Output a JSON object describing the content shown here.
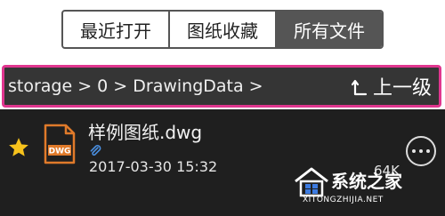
{
  "tabs": [
    {
      "label": "最近打开",
      "active": false
    },
    {
      "label": "图纸收藏",
      "active": false
    },
    {
      "label": "所有文件",
      "active": true
    }
  ],
  "breadcrumb": {
    "path": "storage > 0 > DrawingData >",
    "up_label": "上一级",
    "up_icon": "return-up-icon"
  },
  "file": {
    "name": "样例图纸.dwg",
    "date": "2017-03-30 15:32",
    "size": "64K",
    "type_label": "DWG",
    "favorite": true
  },
  "watermark": {
    "text": "系统之家",
    "url": "XITONGZHIJIA.NET"
  },
  "colors": {
    "accent": "#e0368f",
    "star": "#f6c21c",
    "file_icon": "#e07a2a",
    "list_bg": "#1f1f1f"
  }
}
